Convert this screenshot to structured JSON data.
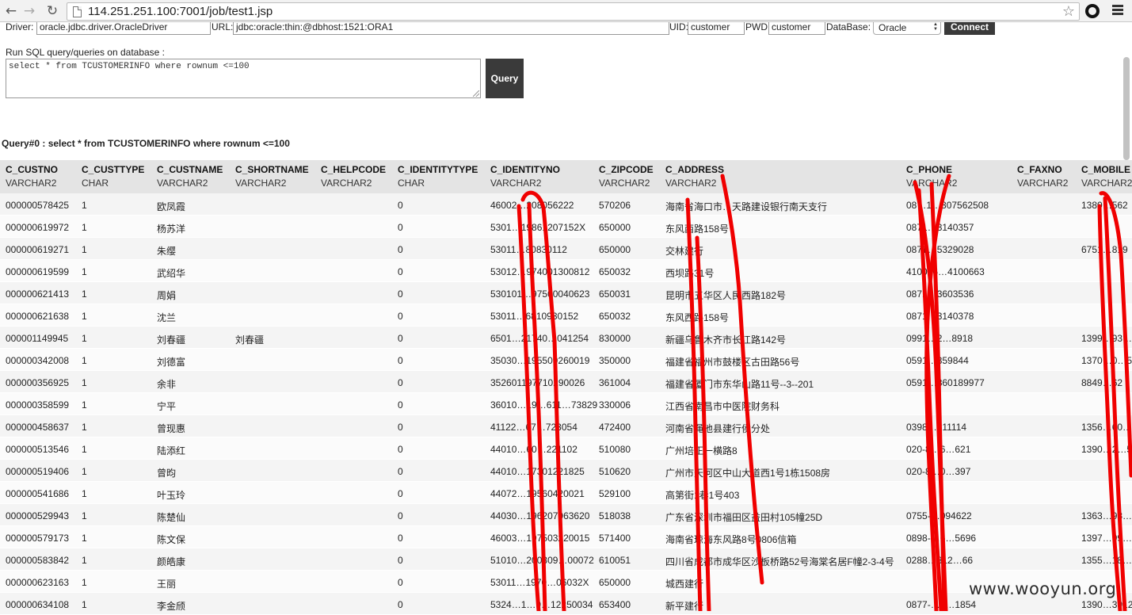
{
  "browser": {
    "back_glyph": "←",
    "forward_glyph": "→",
    "reload_glyph": "↻",
    "url": "114.251.251.100:7001/job/test1.jsp",
    "star_glyph": "☆"
  },
  "connection": {
    "driver_label": "Driver:",
    "driver_value": "oracle.jdbc.driver.OracleDriver",
    "url_label": "URL:",
    "url_value": "jdbc:oracle:thin:@dbhost:1521:ORA1",
    "uid_label": "UID:",
    "uid_value": "customer",
    "pwd_label": "PWD:",
    "pwd_value": "customer",
    "db_label": "DataBase:",
    "db_value": "Oracle",
    "connect_label": "Connect"
  },
  "sql": {
    "label": "Run SQL query/queries on database :",
    "query": "select * from TCUSTOMERINFO where rownum <=100",
    "query_button": "Query"
  },
  "result_title": "Query#0 : select * from TCUSTOMERINFO where rownum <=100",
  "columns": [
    {
      "name": "C_CUSTNO",
      "type": "VARCHAR2"
    },
    {
      "name": "C_CUSTTYPE",
      "type": "CHAR"
    },
    {
      "name": "C_CUSTNAME",
      "type": "VARCHAR2"
    },
    {
      "name": "C_SHORTNAME",
      "type": "VARCHAR2"
    },
    {
      "name": "C_HELPCODE",
      "type": "VARCHAR2"
    },
    {
      "name": "C_IDENTITYTYPE",
      "type": "CHAR"
    },
    {
      "name": "C_IDENTITYNO",
      "type": "VARCHAR2"
    },
    {
      "name": "C_ZIPCODE",
      "type": "VARCHAR2"
    },
    {
      "name": "C_ADDRESS",
      "type": "VARCHAR2"
    },
    {
      "name": "C_PHONE",
      "type": "VARCHAR2"
    },
    {
      "name": "C_FAXNO",
      "type": "VARCHAR2"
    },
    {
      "name": "C_MOBILE",
      "type": "VARCHAR2"
    }
  ],
  "rows": [
    [
      "000000578425",
      "1",
      "欧凤霞",
      "",
      "",
      "0",
      "46002…208056222",
      "570206",
      "海南省海口市…天路建设银行南天支行",
      "08…1…807562508",
      "",
      "1380…562"
    ],
    [
      "000000619972",
      "1",
      "杨苏洋",
      "",
      "",
      "0",
      "5301…19861207152X",
      "650000",
      "东风西路158号",
      "0871…3140357",
      "",
      ""
    ],
    [
      "000000619271",
      "1",
      "朱缨",
      "",
      "",
      "0",
      "53011…80830112",
      "650000",
      "交林建行",
      "0871…5329028",
      "",
      "6751…819"
    ],
    [
      "000000619599",
      "1",
      "武绍华",
      "",
      "",
      "0",
      "53012…974001300812",
      "650032",
      "西坝路31号",
      "410066…4100663",
      "",
      ""
    ],
    [
      "000000621413",
      "1",
      "周娟",
      "",
      "",
      "0",
      "530101…97500040623",
      "650031",
      "昆明市五华区人民西路182号",
      "0871…3603536",
      "",
      ""
    ],
    [
      "000000621638",
      "1",
      "沈兰",
      "",
      "",
      "0",
      "53011…6810930152",
      "650032",
      "东风西路158号",
      "0871…3140378",
      "",
      ""
    ],
    [
      "000001149945",
      "1",
      "刘春疆",
      "刘春疆",
      "",
      "0",
      "6501…21740…041254",
      "830000",
      "新疆乌鲁木齐市长江路142号",
      "0991…2…8918",
      "",
      "1399…93…6"
    ],
    [
      "000000342008",
      "1",
      "刘德富",
      "",
      "",
      "0",
      "35030…195509260019",
      "350000",
      "福建省福州市鼓楼区古田路56号",
      "0591…359844",
      "",
      "1370…0…5"
    ],
    [
      "000000356925",
      "1",
      "余非",
      "",
      "",
      "0",
      "352601197710290026",
      "361004",
      "福建省厦门市东华山路11号--3--201",
      "0591…860189977",
      "",
      "8849…62"
    ],
    [
      "000000358599",
      "1",
      "宁平",
      "",
      "",
      "0",
      "36010…19…611…73829",
      "330006",
      "江西省南昌市中医院财务科",
      "",
      "",
      ""
    ],
    [
      "000000458637",
      "1",
      "曾现惠",
      "",
      "",
      "0",
      "41122…67…723054",
      "472400",
      "河南省渑池县建行侯分处",
      "0398…811114",
      "",
      "1356…60…"
    ],
    [
      "000000513546",
      "1",
      "陆添红",
      "",
      "",
      "0",
      "44010…60…221102",
      "510080",
      "广州培正一横路8",
      "020-8…6…621",
      "",
      "1390…2…5"
    ],
    [
      "000000519406",
      "1",
      "曾昀",
      "",
      "",
      "0",
      "44010…17301221825",
      "510620",
      "广州市天河区中山大道西1号1栋1508房",
      "020-8…0…397",
      "",
      ""
    ],
    [
      "000000541686",
      "1",
      "叶玉玲",
      "",
      "",
      "0",
      "44072…19560420021",
      "529100",
      "高第街1巷1号403",
      "",
      "",
      ""
    ],
    [
      "000000529943",
      "1",
      "陈楚仙",
      "",
      "",
      "0",
      "44030…196207063620",
      "518038",
      "广东省深圳市福田区益田村105幢25D",
      "0755-…094622",
      "",
      "1363…93…"
    ],
    [
      "000000579173",
      "1",
      "陈文保",
      "",
      "",
      "0",
      "46003…197503220015",
      "571400",
      "海南省琼海东风路8号0806信箱",
      "0898-…6…5696",
      "",
      "1397…99…"
    ],
    [
      "000000583842",
      "1",
      "颜皓康",
      "",
      "",
      "0",
      "51010…200309…00072",
      "610051",
      "四川省成都市成华区沙板桥路52号海棠名居F幢2-3-4号",
      "0288…812…66",
      "",
      "1355…18…"
    ],
    [
      "000000623163",
      "1",
      "王丽",
      "",
      "",
      "0",
      "53011…1970…06032X",
      "650000",
      "城西建行",
      "",
      "",
      ""
    ],
    [
      "000000634108",
      "1",
      "李金颀",
      "",
      "",
      "0",
      "5324…1…9…12250034",
      "653400",
      "新平建行",
      "0877-…0…1854",
      "",
      "1390…3912"
    ]
  ],
  "watermark": "www.wooyun.org",
  "colors": {
    "marker": "#f00000",
    "button": "#3a3a3a",
    "header_bg": "#e4e4e4"
  }
}
